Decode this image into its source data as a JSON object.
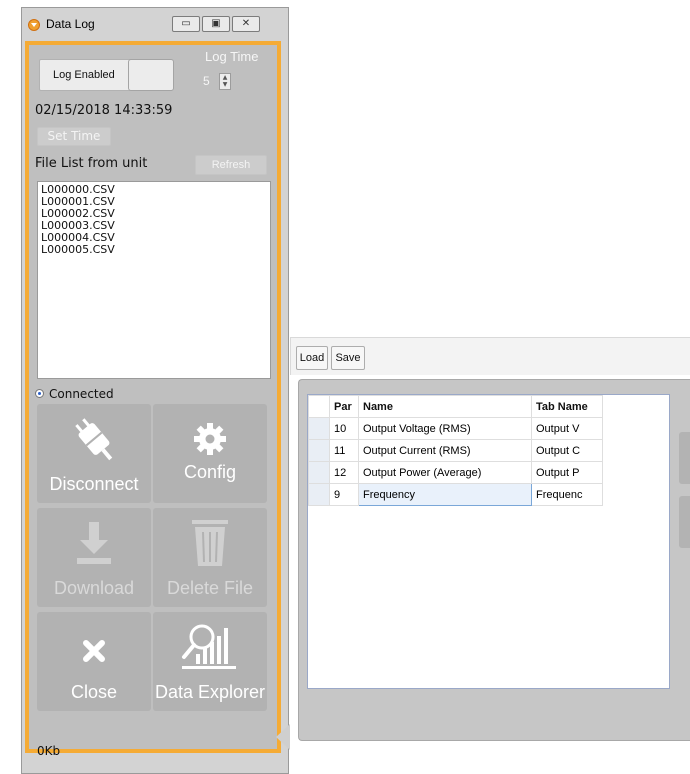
{
  "window": {
    "title": "Data Log",
    "controls": [
      "minimize",
      "maximize",
      "close"
    ]
  },
  "log": {
    "enabled_label": "Log Enabled",
    "time_label": "Log Time",
    "time_value": "5"
  },
  "datetime": "02/15/2018 14:33:59",
  "set_time_label": "Set Time",
  "file_list": {
    "label": "File List from unit",
    "refresh_label": "Refresh",
    "files": [
      "L000000.CSV",
      "L000001.CSV",
      "L000002.CSV",
      "L000003.CSV",
      "L000004.CSV",
      "L000005.CSV"
    ]
  },
  "connection_status": "Connected",
  "tiles": {
    "disconnect": "Disconnect",
    "config": "Config",
    "download": "Download",
    "delete_file": "Delete File",
    "close": "Close",
    "data_explorer": "Data Explorer"
  },
  "status_bar": "0Kb",
  "editor": {
    "load_label": "Load",
    "save_label": "Save",
    "columns": [
      "Par",
      "Name",
      "Tab Name"
    ],
    "rows": [
      {
        "par": "10",
        "name": "Output Voltage (RMS)",
        "tab": "Output V"
      },
      {
        "par": "11",
        "name": "Output Current (RMS)",
        "tab": "Output C"
      },
      {
        "par": "12",
        "name": "Output Power (Average)",
        "tab": "Output P"
      },
      {
        "par": "9",
        "name": "Frequency",
        "tab": "Frequenc"
      }
    ]
  },
  "colors": {
    "accent": "#f5ab35",
    "panel_bg": "#bfbfbf",
    "tile_bg": "#b2b2b2"
  }
}
